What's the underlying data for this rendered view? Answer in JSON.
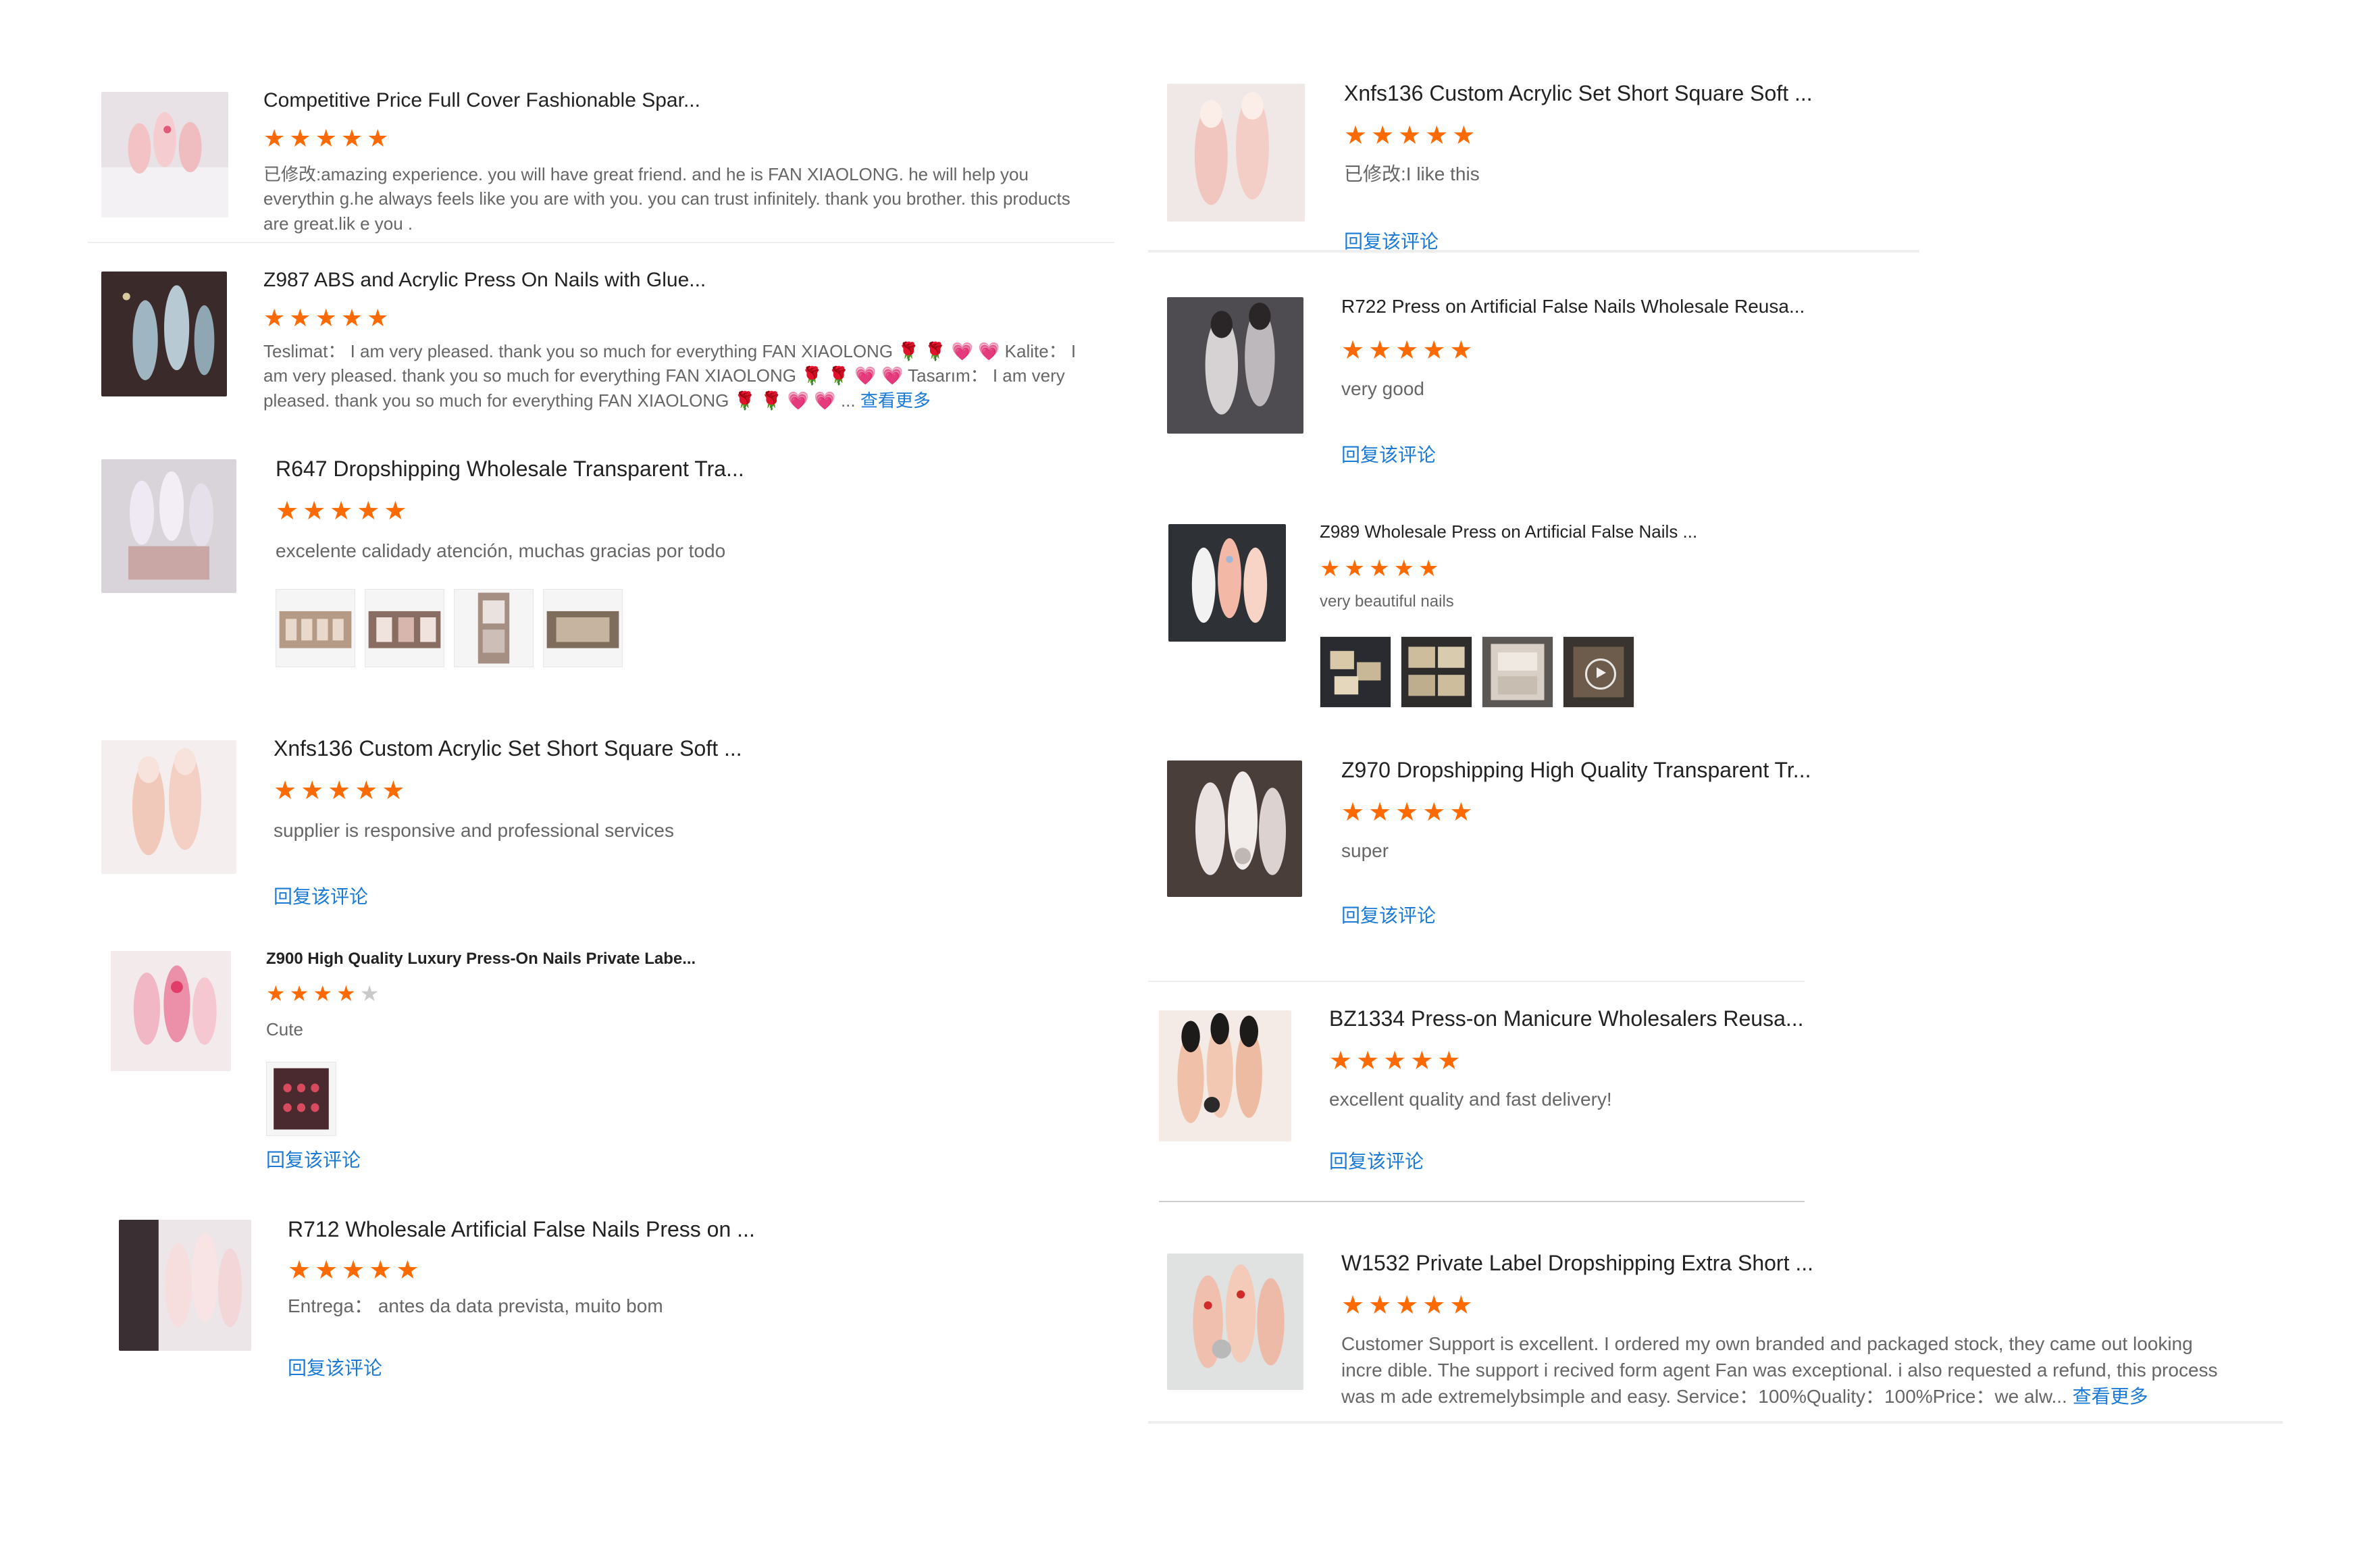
{
  "colors": {
    "star": "#ff6a00",
    "link": "#1a7ad6",
    "text": "#666666",
    "title": "#222222"
  },
  "reviews": [
    {
      "title": "Competitive Price Full Cover Fashionable Spar...",
      "rating": 5,
      "text": "已修改:amazing experience. you will have great friend. and he is FAN XIAOLONG. he will help you everythin g.he always feels like you are with you. you can trust infinitely. thank you brother. this products are great.lik e you ."
    },
    {
      "title": "Z987 ABS and Acrylic Press On Nails with Glue...",
      "rating": 5,
      "text": "Teslimat： I am very pleased. thank you so much for everything FAN XIAOLONG 🌹 🌹 💗 💗 Kalite： I am very pleased. thank you so much for everything FAN XIAOLONG 🌹 🌹 💗 💗 Tasarım： I am very pleased. thank you so much for everything FAN XIAOLONG 🌹 🌹 💗 💗 ...",
      "more": "查看更多"
    },
    {
      "title": "R647 Dropshipping Wholesale Transparent Tra...",
      "rating": 5,
      "text": "excelente calidady atención, muchas gracias por todo"
    },
    {
      "title": "Xnfs136 Custom Acrylic Set Short Square Soft ...",
      "rating": 5,
      "text": "supplier is responsive and professional services",
      "reply": "回复该评论"
    },
    {
      "title": "Z900 High Quality Luxury Press-On Nails Private Labe...",
      "rating": 4,
      "text": "Cute",
      "reply": "回复该评论"
    },
    {
      "title": "R712 Wholesale Artificial False Nails Press on ...",
      "rating": 5,
      "text": "Entrega： antes da data prevista, muito bom",
      "reply": "回复该评论"
    },
    {
      "title": "Xnfs136 Custom Acrylic Set Short Square Soft ...",
      "rating": 5,
      "text": "已修改:I like this",
      "reply": "回复该评论"
    },
    {
      "title": "R722 Press on Artificial False Nails Wholesale Reusa...",
      "rating": 5,
      "text": "very good",
      "reply": "回复该评论"
    },
    {
      "title": "Z989 Wholesale Press on Artificial False Nails ...",
      "rating": 5,
      "text": "very beautiful nails"
    },
    {
      "title": "Z970 Dropshipping High Quality Transparent Tr...",
      "rating": 5,
      "text": "super",
      "reply": "回复该评论"
    },
    {
      "title": "BZ1334 Press-on Manicure Wholesalers Reusa...",
      "rating": 5,
      "text": "excellent quality and fast delivery!",
      "reply": "回复该评论"
    },
    {
      "title": "W1532 Private Label Dropshipping Extra Short ...",
      "rating": 5,
      "text": "Customer Support is excellent. I ordered my own branded and packaged stock, they came out looking incre dible. The support i recived form agent Fan was exceptional. i also requested a refund, this process was m ade extremelybsimple and easy. Service：100%Quality：100%Price：we alw...",
      "more": "查看更多"
    }
  ]
}
